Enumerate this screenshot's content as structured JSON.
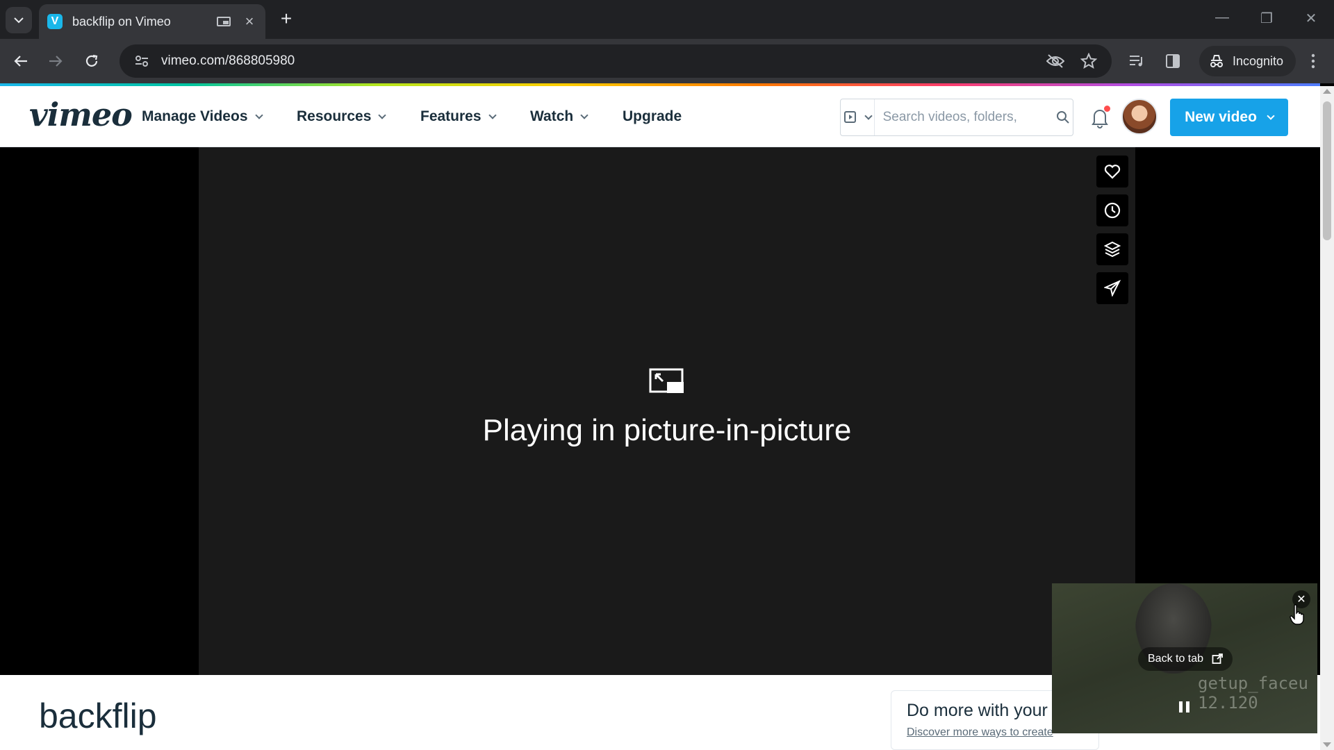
{
  "browser": {
    "tab_title": "backflip on Vimeo",
    "url": "vimeo.com/868805980",
    "incognito_label": "Incognito"
  },
  "vimeo_header": {
    "logo_text": "vimeo",
    "nav": [
      {
        "label": "Manage Videos"
      },
      {
        "label": "Resources"
      },
      {
        "label": "Features"
      },
      {
        "label": "Watch"
      },
      {
        "label": "Upgrade"
      }
    ],
    "search_placeholder": "Search videos, folders, ",
    "new_video_label": "New video"
  },
  "player": {
    "pip_message": "Playing in picture-in-picture",
    "side_actions": [
      "heart-icon",
      "clock-icon",
      "layers-icon",
      "send-icon"
    ]
  },
  "video": {
    "title": "backflip"
  },
  "promo": {
    "title": "Do more with your",
    "link": "Discover more ways to create"
  },
  "pip_window": {
    "back_to_tab": "Back to tab",
    "overlay_line1": "getup_faceu",
    "overlay_line2": "12.120"
  },
  "colors": {
    "accent": "#17a2e8",
    "vimeo_text": "#1a2e3b",
    "chrome_dark": "#202124",
    "chrome_toolbar": "#35363a"
  }
}
